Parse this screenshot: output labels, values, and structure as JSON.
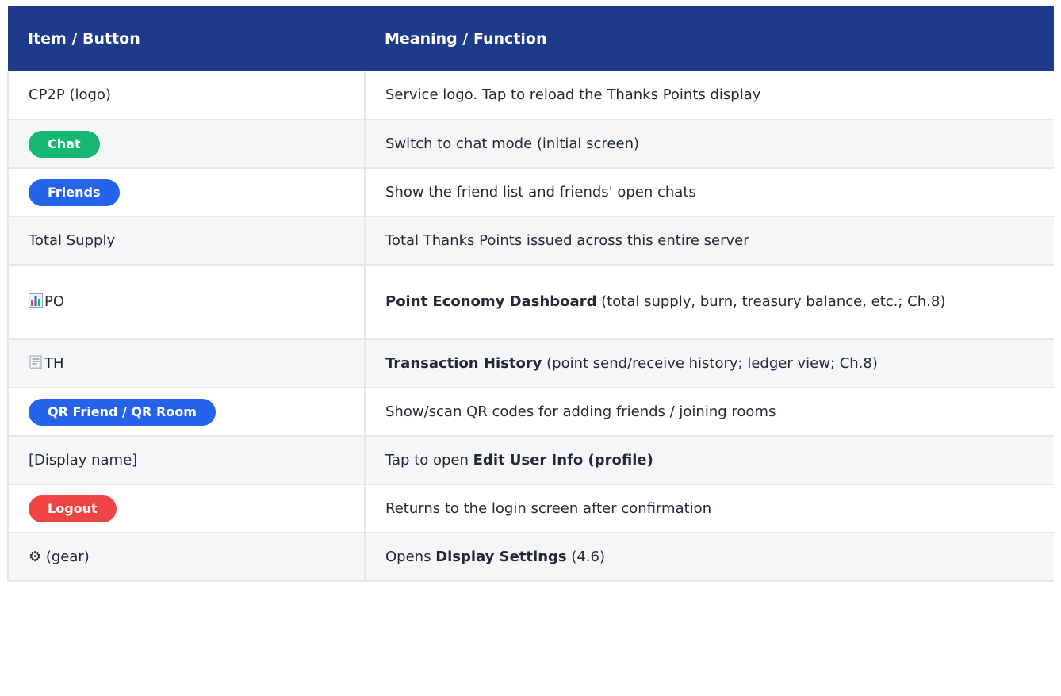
{
  "table": {
    "headers": [
      "Item / Button",
      "Meaning / Function"
    ],
    "rows": [
      {
        "item": "CP2P (logo)",
        "meaning": "Service logo. Tap to reload the Thanks Points display"
      },
      {
        "item": "Chat",
        "meaning": "Switch to chat mode (initial screen)"
      },
      {
        "item": "Friends",
        "meaning": "Show the friend list and friends' open chats"
      },
      {
        "item": "Total Supply",
        "meaning": "Total Thanks Points issued across this entire server"
      },
      {
        "item": "PO",
        "meaning_bold": "Point Economy Dashboard",
        "meaning_rest": " (total supply, burn, treasury balance, etc.; Ch.8)"
      },
      {
        "item": "TH",
        "meaning_bold": "Transaction History",
        "meaning_rest": " (point send/receive history; ledger view; Ch.8)"
      },
      {
        "item": "QR Friend / QR Room",
        "meaning": "Show/scan QR codes for adding friends / joining rooms"
      },
      {
        "item": "[Display name]",
        "meaning_pre": "Tap to open ",
        "meaning_bold": "Edit User Info (profile)"
      },
      {
        "item": "Logout",
        "meaning": "Returns to the login screen after confirmation"
      },
      {
        "item": "⚙ (gear)",
        "meaning_pre": "Opens ",
        "meaning_bold": "Display Settings",
        "meaning_rest": " (4.6)"
      }
    ]
  },
  "colors": {
    "header_bg": "#1e3a8a",
    "pill_green": "#14b873",
    "pill_blue": "#2563eb",
    "pill_red": "#ef4444"
  },
  "icons": {
    "po": "bar-chart-icon",
    "th": "receipt-icon",
    "gear": "gear-icon"
  }
}
